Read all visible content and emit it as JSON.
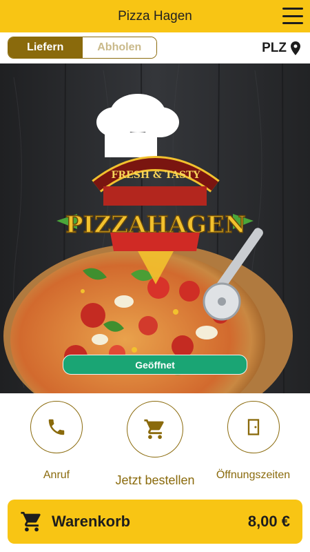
{
  "header": {
    "title": "Pizza Hagen",
    "menu_icon": "hamburger-menu-icon"
  },
  "mode_toggle": {
    "options": [
      "Liefern",
      "Abholen"
    ],
    "selected": "Liefern"
  },
  "plz": {
    "label": "PLZ",
    "icon": "location-pin-icon"
  },
  "hero": {
    "logo": {
      "tagline": "FRESH & TASTY",
      "brand": "PIZZAHAGEN"
    },
    "status_label": "Geöffnet"
  },
  "actions": [
    {
      "label": "Anruf",
      "icon": "phone-icon"
    },
    {
      "label": "Jetzt bestellen",
      "icon": "cart-icon"
    },
    {
      "label": "Öffnungszeiten",
      "icon": "door-icon"
    }
  ],
  "cart": {
    "label": "Warenkorb",
    "total": "8,00 €",
    "icon": "cart-icon"
  },
  "colors": {
    "accent_yellow": "#f8c514",
    "brand_brown": "#8a6a0c",
    "status_green": "#1aa574",
    "toggle_inactive_text": "#c9b98a"
  }
}
